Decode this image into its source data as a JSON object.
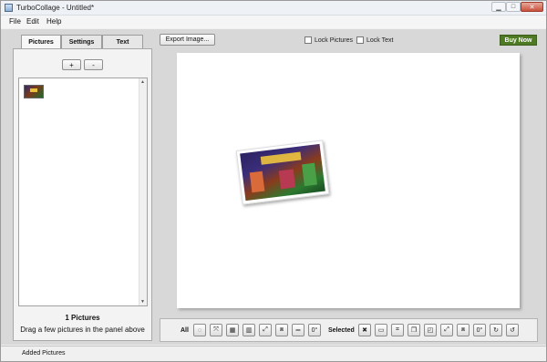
{
  "window": {
    "title": "TurboCollage - Untitled*"
  },
  "menu": [
    "File",
    "Edit",
    "Help"
  ],
  "tabs": [
    "Pictures",
    "Settings",
    "Text"
  ],
  "left_panel": {
    "add_label": "+",
    "remove_label": "-",
    "count": "1 Pictures",
    "hint": "Drag a few pictures in the panel above"
  },
  "top": {
    "export_label": "Export Image...",
    "lock_pictures": "Lock Pictures",
    "lock_text": "Lock Text",
    "buy_now": "Buy Now"
  },
  "toolbar": {
    "all_label": "All",
    "selected_label": "Selected",
    "all_tools": [
      {
        "name": "shuffle-icon",
        "glyph": "◌"
      },
      {
        "name": "fit-icon",
        "glyph": "⤧"
      },
      {
        "name": "grid-layout-icon",
        "glyph": "▦"
      },
      {
        "name": "mosaic-layout-icon",
        "glyph": "▥"
      },
      {
        "name": "expand-icon",
        "glyph": "⤢"
      },
      {
        "name": "compress-icon",
        "glyph": "⧈"
      },
      {
        "name": "align-icon",
        "glyph": "═"
      },
      {
        "name": "rotate-zero-icon",
        "glyph": "0°"
      }
    ],
    "selected_tools": [
      {
        "name": "remove-icon",
        "glyph": "✖"
      },
      {
        "name": "image-icon",
        "glyph": "▭"
      },
      {
        "name": "crop-icon",
        "glyph": "⌗"
      },
      {
        "name": "layers-icon",
        "glyph": "❐"
      },
      {
        "name": "bring-front-icon",
        "glyph": "◰"
      },
      {
        "name": "expand-selected-icon",
        "glyph": "⤢"
      },
      {
        "name": "compress-selected-icon",
        "glyph": "⧈"
      },
      {
        "name": "rotate-zero-selected-icon",
        "glyph": "0°"
      },
      {
        "name": "rotate-right-icon",
        "glyph": "↻"
      },
      {
        "name": "rotate-left-icon",
        "glyph": "↺"
      }
    ]
  },
  "status": {
    "text": "Added Pictures"
  },
  "colors": {
    "buy_now": "#4f7a24",
    "canvas": "#ffffff",
    "workarea": "#d8d8d8"
  }
}
